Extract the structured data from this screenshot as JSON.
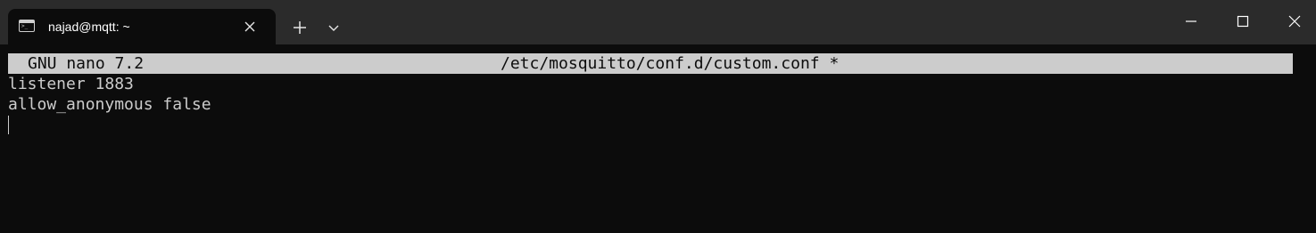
{
  "window": {
    "tab_title": "najad@mqtt: ~",
    "tab_icon": "terminal-icon"
  },
  "toolbar": {
    "new_tab_icon": "plus-icon",
    "dropdown_icon": "chevron-down-icon"
  },
  "window_controls": {
    "minimize_icon": "minimize-icon",
    "maximize_icon": "maximize-icon",
    "close_icon": "close-icon"
  },
  "nano": {
    "version": "GNU nano 7.2",
    "filename": "/etc/mosquitto/conf.d/custom.conf *"
  },
  "editor": {
    "lines": [
      "listener 1883",
      "allow_anonymous false"
    ]
  },
  "colors": {
    "titlebar_bg": "#2b2b2b",
    "terminal_bg": "#0c0c0c",
    "text": "#cccccc",
    "header_bg": "#cccccc"
  }
}
